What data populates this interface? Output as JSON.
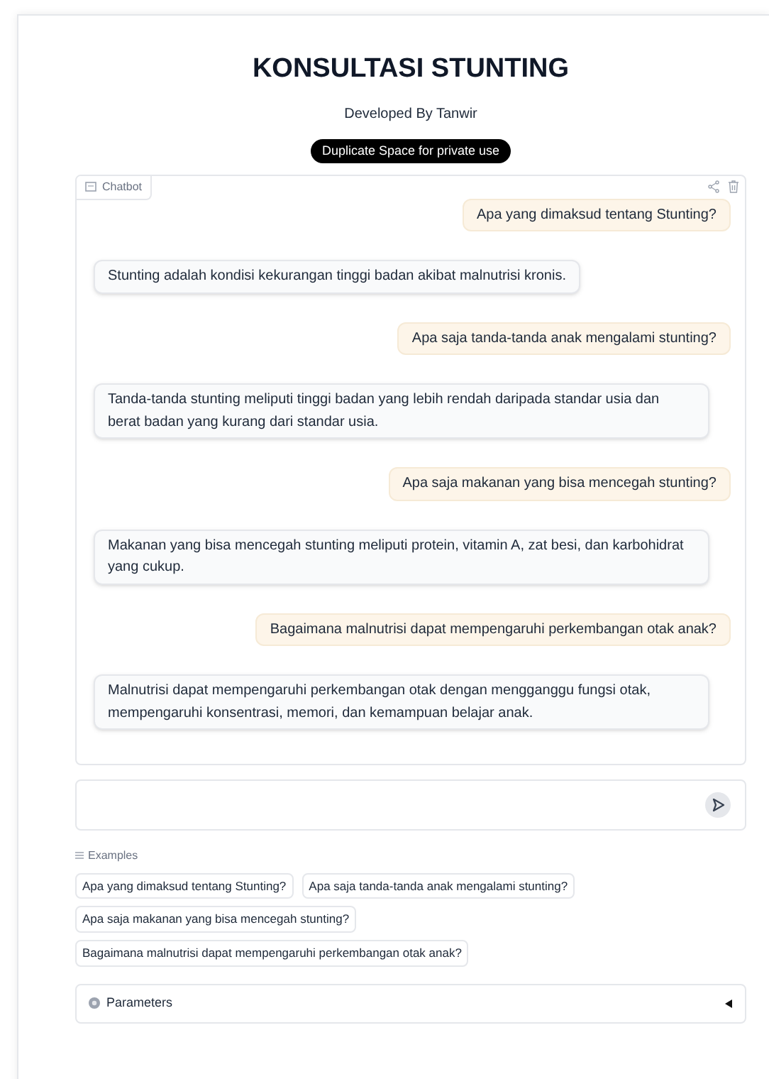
{
  "title": "KONSULTASI STUNTING",
  "subtitle": "Developed By Tanwir",
  "duplicate_button": "Duplicate Space for private use",
  "chatbot": {
    "label": "Chatbot",
    "messages": [
      {
        "kind": "user",
        "text": "Apa yang dimaksud tentang Stunting?"
      },
      {
        "kind": "bot",
        "text": "Stunting adalah kondisi kekurangan tinggi badan akibat malnutrisi kronis."
      },
      {
        "kind": "user",
        "text": "Apa saja tanda-tanda anak mengalami stunting?"
      },
      {
        "kind": "bot",
        "text": "Tanda-tanda stunting meliputi tinggi badan yang lebih rendah daripada standar usia dan berat badan yang kurang dari standar usia."
      },
      {
        "kind": "user",
        "text": "Apa saja makanan yang bisa mencegah stunting?"
      },
      {
        "kind": "bot",
        "text": "Makanan yang bisa mencegah stunting meliputi protein, vitamin A, zat besi, dan karbohidrat yang cukup."
      },
      {
        "kind": "user",
        "text": "Bagaimana malnutrisi dapat mempengaruhi perkembangan otak anak?"
      },
      {
        "kind": "bot",
        "text": "Malnutrisi dapat mempengaruhi perkembangan otak dengan mengganggu fungsi otak, mempengaruhi konsentrasi, memori, dan kemampuan belajar anak."
      }
    ]
  },
  "examples": {
    "label": "Examples",
    "items": [
      "Apa yang dimaksud tentang Stunting?",
      "Apa saja tanda-tanda anak mengalami stunting?",
      "Apa saja makanan yang bisa mencegah stunting?",
      "Bagaimana malnutrisi dapat mempengaruhi perkembangan otak anak?"
    ]
  },
  "parameters": {
    "label": "Parameters",
    "expanded": false
  }
}
